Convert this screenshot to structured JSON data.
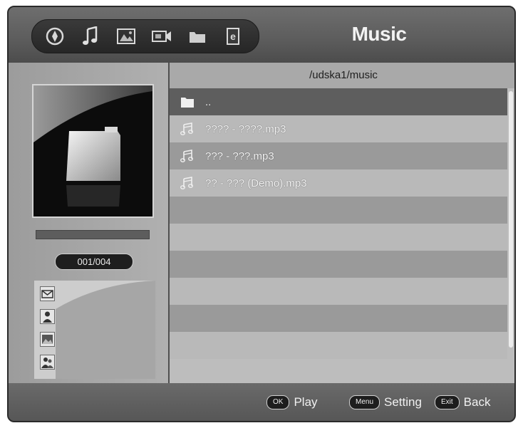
{
  "header": {
    "title": "Music",
    "category_icons": [
      {
        "name": "all-media-icon"
      },
      {
        "name": "music-note-icon"
      },
      {
        "name": "photo-icon"
      },
      {
        "name": "video-icon"
      },
      {
        "name": "folder-icon"
      },
      {
        "name": "ebook-icon"
      }
    ]
  },
  "browser": {
    "path": "/udska1/music",
    "files": [
      {
        "name": "..",
        "type": "folder",
        "selected": true
      },
      {
        "name": "???? - ????.mp3",
        "type": "music"
      },
      {
        "name": "??? - ???.mp3",
        "type": "music"
      },
      {
        "name": "?? - ??? (Demo).mp3",
        "type": "music"
      }
    ],
    "empty_rows": 6
  },
  "preview": {
    "counter": "001/004",
    "progress_fraction": 0.0
  },
  "footer": {
    "hints": [
      {
        "key": "OK",
        "label": "Play"
      },
      {
        "key": "Menu",
        "label": "Setting"
      },
      {
        "key": "Exit",
        "label": "Back"
      }
    ]
  },
  "colors": {
    "selected_row": "#5e5e5e",
    "row_dark": "#9a9a9a",
    "row_light": "#b9b9b9"
  }
}
